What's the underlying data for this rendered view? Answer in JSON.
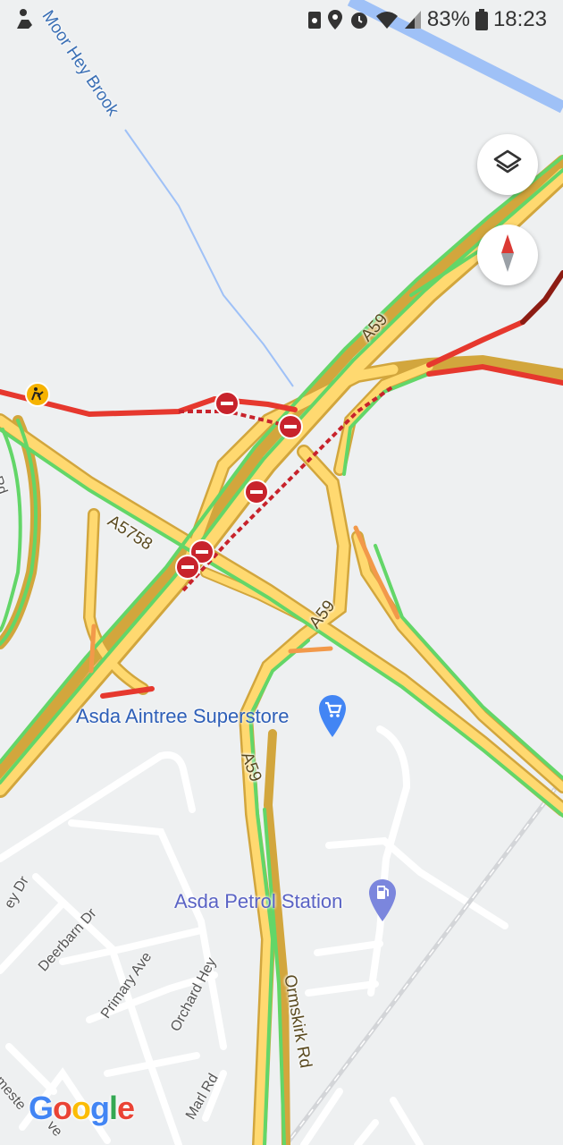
{
  "status_bar": {
    "battery": "83%",
    "time": "18:23",
    "icons": [
      "accessibility-icon",
      "screenshot-icon",
      "location-icon",
      "alarm-icon",
      "wifi-icon",
      "signal-icon",
      "battery-icon"
    ]
  },
  "map": {
    "water_labels": [
      "Moor Hey Brook"
    ],
    "road_labels": {
      "a59_north": "A59",
      "a5758": "A5758",
      "a59_center": "A59",
      "a59_south": "A59",
      "ormskirk_rd": "Ormskirk Rd"
    },
    "street_labels": {
      "deerbarn_dr": "Deerbarn Dr",
      "primary_ave": "Primary Ave",
      "orchard_hey": "Orchard Hey",
      "marl_rd": "Marl Rd",
      "ley_dr": "ey Dr",
      "rd_left": "Rd",
      "meste": "meste",
      "ave": "ve"
    },
    "pois": {
      "asda_superstore": {
        "name": "Asda Aintree Superstore",
        "icon": "shopping-cart-icon"
      },
      "asda_petrol": {
        "name": "Asda Petrol Station",
        "icon": "fuel-pump-icon"
      }
    },
    "incidents": {
      "road_closed_icon": "road-closed-icon",
      "roadworks_icon": "roadworks-icon"
    },
    "traffic_colors": {
      "free": "#63d668",
      "moderate": "#ffcf4a",
      "slow": "#f2994a",
      "heavy": "#e6382e",
      "severe": "#8c1c13"
    }
  },
  "controls": {
    "layers_icon": "layers-icon",
    "compass_icon": "compass-icon"
  },
  "branding": {
    "logo": "Google"
  }
}
